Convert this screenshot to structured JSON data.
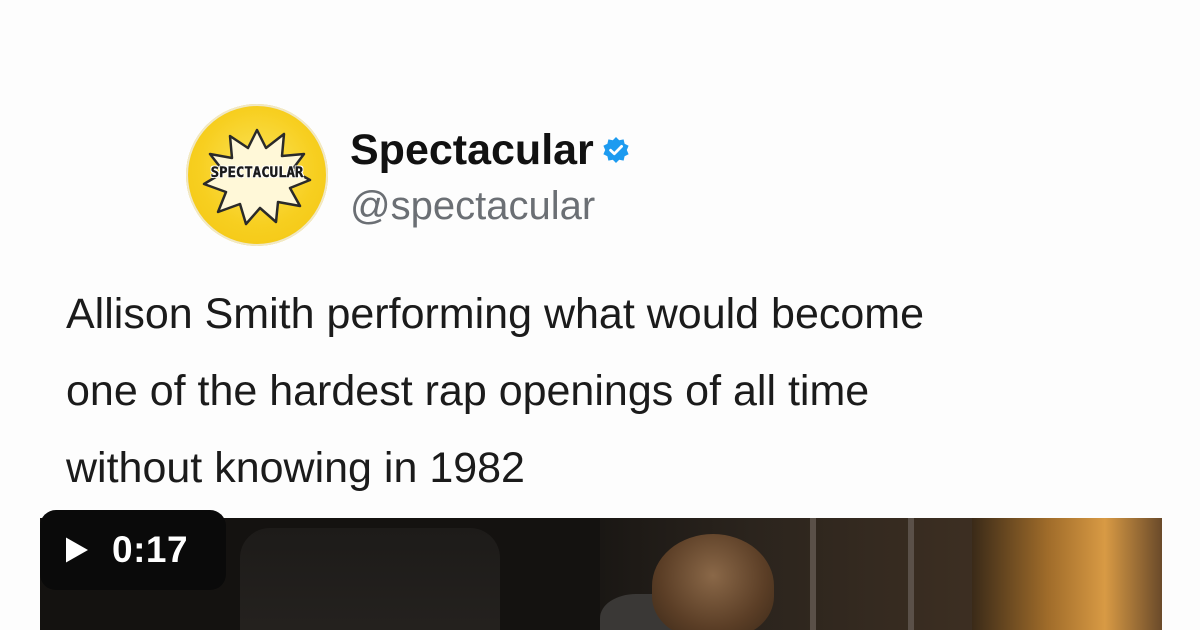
{
  "profile": {
    "display_name": "Spectacular",
    "handle": "@spectacular",
    "avatar_word": "SPECTACULAR",
    "avatar_color": "#f7cf20",
    "verified_icon": "verified-badge-icon",
    "verified_color": "#1d9bf0"
  },
  "tweet": {
    "lines": [
      "Allison Smith performing what would become",
      "one of the hardest rap openings of all time",
      "without knowing in 1982"
    ]
  },
  "video": {
    "duration": "0:17",
    "play_icon": "play-icon"
  }
}
